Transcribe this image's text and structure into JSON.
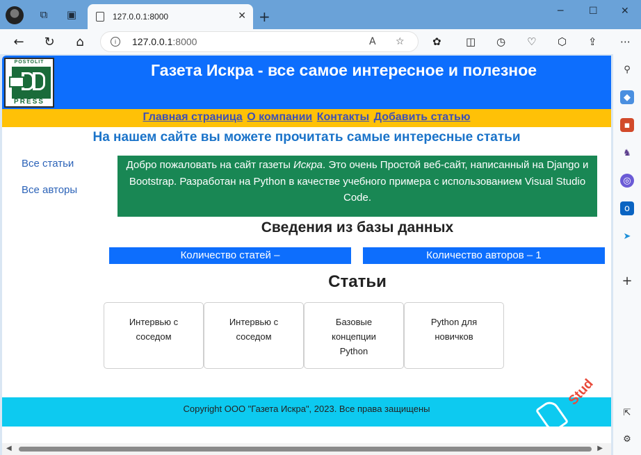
{
  "browser": {
    "tab_title": "127.0.0.1:8000",
    "address_host": "127.0.0.1",
    "address_port": ":8000"
  },
  "site": {
    "logo_top": "POSTOLIT",
    "logo_bottom": "PRESS",
    "title": "Газета Искра - все самое интересное и полезное",
    "menu": [
      "Главная страница",
      "О компании",
      "Контакты",
      "Добавить статью"
    ],
    "subtitle": "На нашем сайте вы можете прочитать самые интересные статьи",
    "left_nav": [
      "Все статьи",
      "Все авторы"
    ],
    "welcome_before": "Добро пожаловать на сайт газеты ",
    "welcome_em": "Искра",
    "welcome_after": ". Это очень Простой веб-сайт, написанный на Django и Bootstrap. Разработан на Python в качестве учебного примера с использованием Visual Studio Code.",
    "db_heading": "Сведения из базы данных",
    "articles_count": "Количество статей –",
    "authors_count": "Количество авторов – 1",
    "articles_heading": "Статьи",
    "articles": [
      "Интервью с соседом",
      "Интервью с соседом",
      "Базовые концепции Python",
      "Python для новичков"
    ],
    "footer": "Copyright ООО \"Газета Искра\", 2023. Все права защищены"
  },
  "watermark": "Stud",
  "icons": {
    "sidebar": [
      "search-icon",
      "tag-icon",
      "toolbox-icon",
      "chess-icon",
      "copilot-icon",
      "outlook-icon",
      "send-icon",
      "plus-icon",
      "external-link-icon",
      "settings-icon"
    ]
  }
}
